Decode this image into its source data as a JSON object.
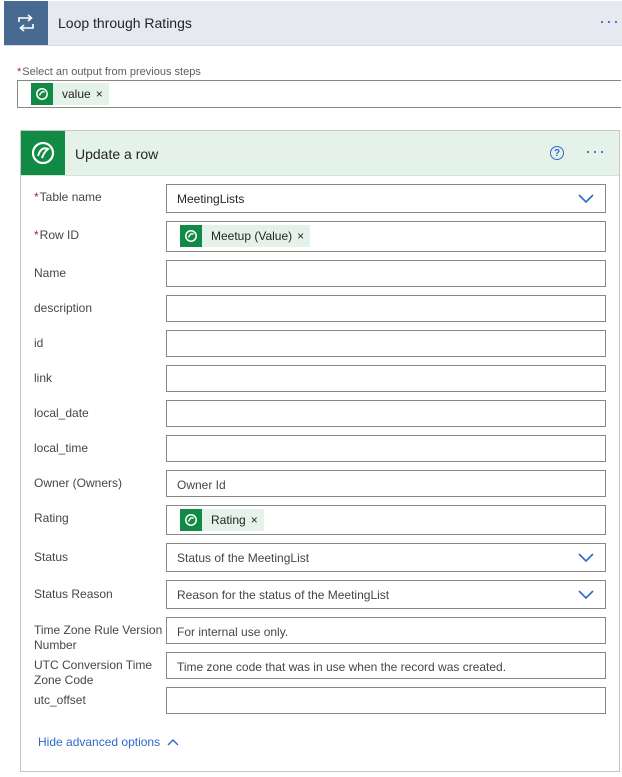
{
  "loop": {
    "title": "Loop through Ratings",
    "icon": "loop-icon",
    "more": "···"
  },
  "select_output": {
    "required_mark": "*",
    "label": "Select an output from previous steps",
    "token": {
      "label": "value",
      "remove": "×"
    }
  },
  "action": {
    "title": "Update a row",
    "icon": "dataverse-icon",
    "help": "?",
    "more": "···",
    "fields": [
      {
        "label": "Table name",
        "required": true,
        "type": "dropdown",
        "value": "MeetingLists"
      },
      {
        "label": "Row ID",
        "required": true,
        "type": "token",
        "token": "Meetup (Value)"
      },
      {
        "label": "Name",
        "type": "text",
        "placeholder": ""
      },
      {
        "label": "description",
        "type": "text",
        "placeholder": ""
      },
      {
        "label": "id",
        "type": "text",
        "placeholder": ""
      },
      {
        "label": "link",
        "type": "text",
        "placeholder": ""
      },
      {
        "label": "local_date",
        "type": "text",
        "placeholder": ""
      },
      {
        "label": "local_time",
        "type": "text",
        "placeholder": ""
      },
      {
        "label": "Owner (Owners)",
        "type": "text",
        "placeholder": "Owner Id"
      },
      {
        "label": "Rating",
        "type": "token",
        "token": "Rating"
      },
      {
        "label": "Status",
        "type": "dropdown",
        "placeholder": "Status of the MeetingList"
      },
      {
        "label": "Status Reason",
        "type": "dropdown",
        "placeholder": "Reason for the status of the MeetingList"
      },
      {
        "label": "Time Zone Rule Version Number",
        "type": "text",
        "placeholder": "For internal use only."
      },
      {
        "label": "UTC Conversion Time Zone Code",
        "type": "text",
        "placeholder": "Time zone code that was in use when the record was created."
      },
      {
        "label": "utc_offset",
        "type": "text",
        "placeholder": ""
      }
    ],
    "hide_advanced": "Hide advanced options"
  },
  "colors": {
    "accent": "#2b6acb",
    "dataverse_green": "#108a44",
    "loop_blue": "#486991",
    "required": "#a4262c"
  }
}
